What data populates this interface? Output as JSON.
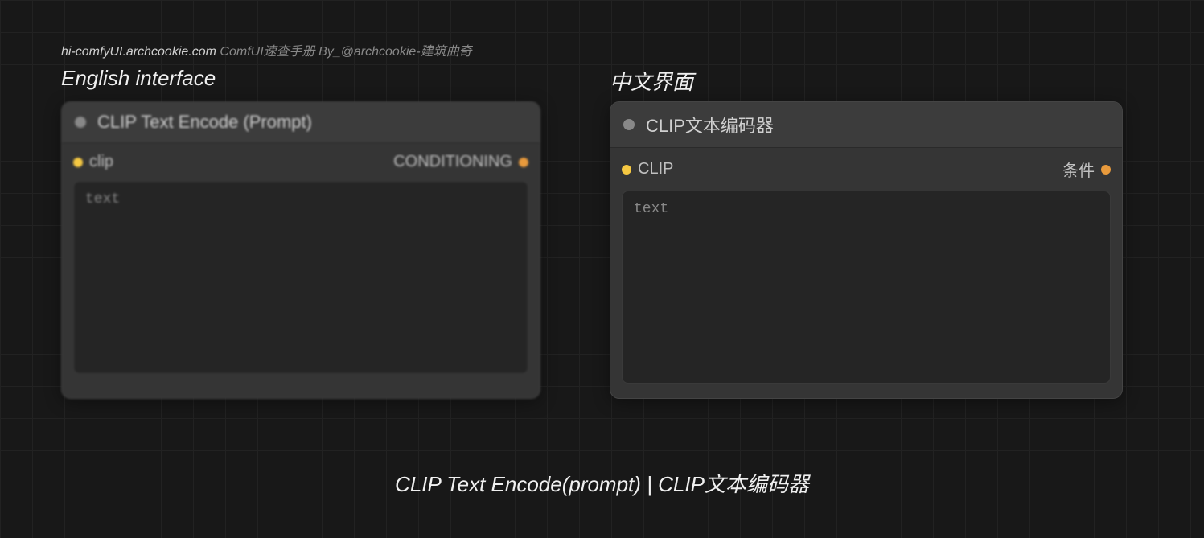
{
  "watermark": {
    "site": "hi-comfyUI.archcookie.com",
    "desc": "ComfUI速查手册 By_@archcookie-建筑曲奇"
  },
  "labels": {
    "english": "English interface",
    "chinese": "中文界面"
  },
  "node_en": {
    "title": "CLIP Text Encode (Prompt)",
    "input_label": "clip",
    "output_label": "CONDITIONING",
    "text_placeholder": "text"
  },
  "node_cn": {
    "title": "CLIP文本编码器",
    "input_label": "CLIP",
    "output_label": "条件",
    "text_placeholder": "text"
  },
  "footer": "CLIP Text Encode(prompt)  | CLIP文本编码器"
}
